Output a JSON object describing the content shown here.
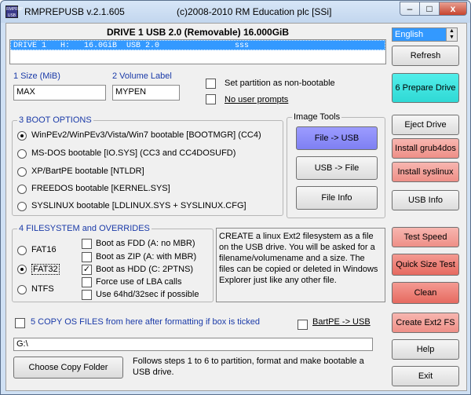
{
  "window": {
    "title": "RMPREPUSB v.2.1.605",
    "copyright": "(c)2008-2010 RM Education plc [SSi]",
    "icon_text": "RMPREP USB",
    "min": "–",
    "max": "□",
    "close": "x"
  },
  "drive": {
    "header": "DRIVE 1 USB 2.0  (Removable) 16.000GiB",
    "list_row": "DRIVE 1   H:   16.0GiB  USB 2.0                sss"
  },
  "language": {
    "selected": "English"
  },
  "size": {
    "label": "1 Size (MiB)",
    "value": "MAX"
  },
  "volume": {
    "label": "2 Volume Label",
    "value": "MYPEN"
  },
  "options": {
    "non_bootable": "Set partition as non-bootable",
    "no_prompts": "No user prompts"
  },
  "boot": {
    "title": "3 BOOT OPTIONS",
    "items": [
      "WinPEv2/WinPEv3/Vista/Win7 bootable [BOOTMGR] (CC4)",
      "MS-DOS bootable [IO.SYS]   (CC3 and CC4DOSUFD)",
      "XP/BartPE bootable [NTLDR]",
      "FREEDOS bootable [KERNEL.SYS]",
      "SYSLINUX bootable [LDLINUX.SYS + SYSLINUX.CFG]"
    ],
    "selected": 0
  },
  "image_tools": {
    "title": "Image Tools",
    "file_to_usb": "File -> USB",
    "usb_to_file": "USB -> File",
    "file_info": "File Info"
  },
  "fs": {
    "title": "4 FILESYSTEM and OVERRIDES",
    "items": [
      "FAT16",
      "FAT32",
      "NTFS"
    ],
    "selected": 1,
    "overrides": [
      "Boot as FDD (A: no MBR)",
      "Boot as ZIP (A: with MBR)",
      "Boot as HDD (C: 2PTNS)",
      "Force use of LBA calls",
      "Use 64hd/32sec if possible"
    ],
    "checked": [
      false,
      false,
      true,
      false,
      false
    ]
  },
  "info_text": "CREATE a linux Ext2 filesystem as a file on the USB drive. You will be asked for a filename/volumename and a size. The files can be copied or deleted in Windows Explorer just like any other file.",
  "copy": {
    "label": "5 COPY OS FILES from here after formatting if box is ticked",
    "bartpe": "BartPE -> USB",
    "path": "G:\\",
    "choose": "Choose Copy Folder",
    "hint": "Follows steps 1 to 6 to partition, format and make bootable a USB drive."
  },
  "side": {
    "refresh": "Refresh",
    "prepare": "6 Prepare Drive",
    "eject": "Eject Drive",
    "grub": "Install grub4dos",
    "syslinux": "Install syslinux",
    "usbinfo": "USB Info",
    "testspeed": "Test Speed",
    "quicksize": "Quick Size Test",
    "clean": "Clean",
    "ext2": "Create Ext2 FS",
    "help": "Help",
    "exit": "Exit"
  }
}
